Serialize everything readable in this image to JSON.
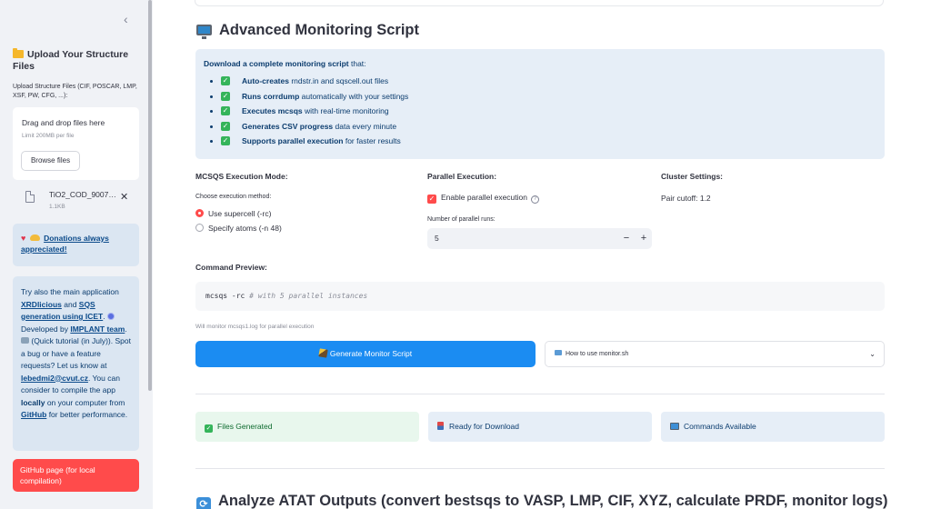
{
  "sidebar": {
    "collapse_glyph": "‹",
    "upload_title": "Upload Your Structure Files",
    "upload_label": "Upload Structure Files (CIF, POSCAR, LMP, XSF, PW, CFG, ...):",
    "dropzone_title": "Drag and drop files here",
    "dropzone_limit": "Limit 200MB per file",
    "browse_label": "Browse files",
    "file": {
      "name": "TiO2_COD_9007…",
      "size": "1.1KB"
    },
    "donation": {
      "text": "Donations always appreciated!"
    },
    "info": {
      "p1": "Try also the main application ",
      "xrd": "XRDlicious",
      "p2": " and ",
      "sqs": "SQS generation using ICET",
      "p3": ". ",
      "p4": " Developed by ",
      "implant": "IMPLANT team",
      "p5": ". ",
      "p6": " (Quick tutorial (in July)). Spot a bug or have a feature requests? Let us know at ",
      "email": "lebedmi2@cvut.cz",
      "p7": ". You can consider to compile the app ",
      "locally": "locally",
      "p8": " on your computer from ",
      "github": "GitHub",
      "p9": " for better performance."
    },
    "github_button": "GitHub page (for local compilation)"
  },
  "main": {
    "section_title": "Advanced Monitoring Script",
    "desc_intro_bold": "Download a complete monitoring script",
    "desc_intro_rest": " that:",
    "features": [
      {
        "bold": "Auto-creates",
        "rest": " rndstr.in and sqscell.out files"
      },
      {
        "bold": "Runs corrdump",
        "rest": " automatically with your settings"
      },
      {
        "bold": "Executes mcsqs",
        "rest": " with real-time monitoring"
      },
      {
        "bold": "Generates CSV progress",
        "rest": " data every minute"
      },
      {
        "bold": "Supports parallel execution",
        "rest": " for faster results"
      }
    ],
    "exec_mode": {
      "title": "MCSQS Execution Mode:",
      "choose_label": "Choose execution method:",
      "options": [
        "Use supercell (-rc)",
        "Specify atoms (-n 48)"
      ]
    },
    "parallel": {
      "title": "Parallel Execution:",
      "checkbox_label": "Enable parallel execution",
      "runs_label": "Number of parallel runs:",
      "runs_value": "5"
    },
    "cluster": {
      "title": "Cluster Settings:",
      "pair_cutoff": "Pair cutoff: 1.2"
    },
    "command": {
      "label": "Command Preview:",
      "cmd": "mcsqs -rc ",
      "comment": "# with 5 parallel instances"
    },
    "monitor_note": "Will monitor mcsqs1.log for parallel execution",
    "generate_button": "Generate Monitor Script",
    "expander_label": "How to use monitor.sh",
    "status": [
      "Files Generated",
      "Ready for Download",
      "Commands Available"
    ],
    "section2_title": "Analyze ATAT Outputs (convert bestsqs to VASP, LMP, CIF, XYZ, calculate PRDF, monitor logs)"
  },
  "colors": {
    "primary": "#ff4b4b",
    "button_blue": "#1b8cf2",
    "info_bg": "#e6eef7",
    "success_bg": "#e8f7ed"
  }
}
